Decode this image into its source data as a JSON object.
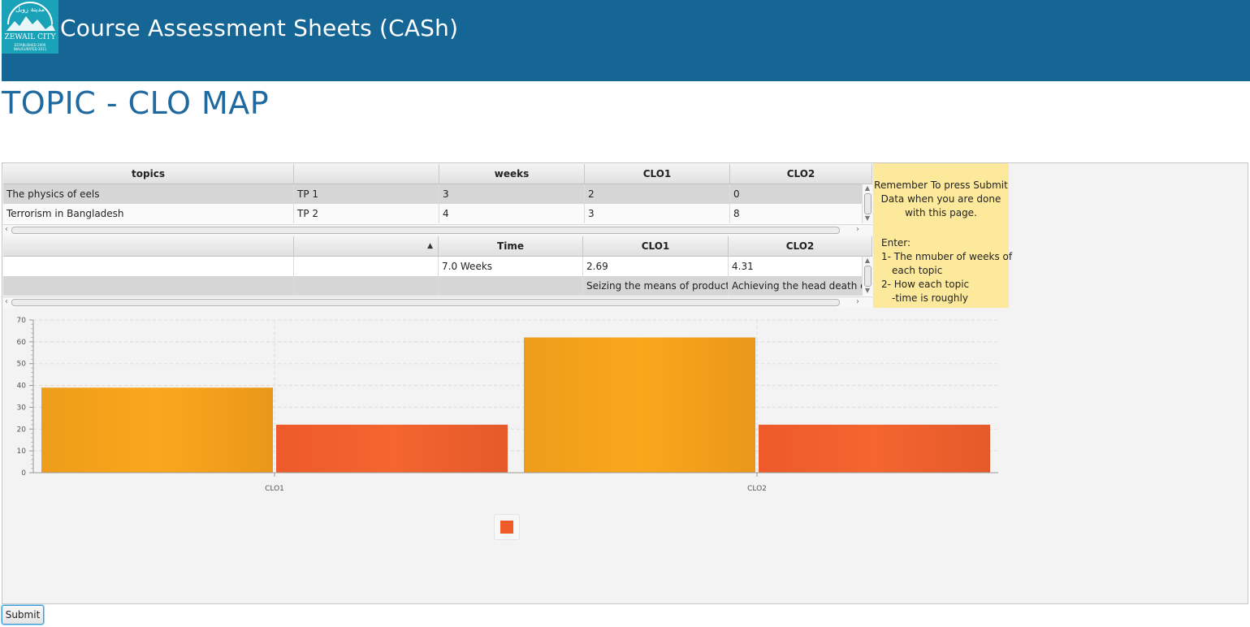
{
  "header": {
    "title": "Course Assessment Sheets (CASh)",
    "logo_text_ar": "مدينة زويل",
    "logo_text": "ZEWAIL CITY",
    "logo_sub1": "ESTABLISHED 2000",
    "logo_sub2": "INAUGURATED 2011"
  },
  "page_title": "TOPIC - CLO MAP",
  "topics_table": {
    "columns": [
      "topics",
      "",
      "weeks",
      "CLO1",
      "CLO2"
    ],
    "rows": [
      [
        "The physics of eels",
        "TP 1",
        "3",
        "2",
        "0"
      ],
      [
        "Terrorism in Bangladesh",
        "TP 2",
        "4",
        "3",
        "8"
      ]
    ]
  },
  "summary_table": {
    "columns": [
      "",
      "",
      "Time",
      "CLO1",
      "CLO2"
    ],
    "sort_icon": "sort-ascending-icon",
    "rows": [
      [
        "",
        "",
        "7.0 Weeks",
        "2.69",
        "4.31"
      ],
      [
        "",
        "",
        "",
        "Seizing the means of production",
        "Achieving the head death of t..."
      ]
    ]
  },
  "note": {
    "line1": "Remember To press Submit",
    "line2": "Data when you are done",
    "line3": "with this page.",
    "enter": "Enter:",
    "item1a": "1- The nmuber of weeks of",
    "item1b": "each topic",
    "item2a": "2- How each topic",
    "item2b": "-time is roughly"
  },
  "chart_data": {
    "type": "bar",
    "categories": [
      "CLO1",
      "CLO2"
    ],
    "series": [
      {
        "values": [
          39,
          62
        ],
        "color": "#f5a31c"
      },
      {
        "values": [
          22,
          22
        ],
        "color": "#f15a29"
      }
    ],
    "ylim": [
      0,
      70
    ],
    "yticks": [
      0,
      10,
      20,
      30,
      40,
      50,
      60,
      70
    ],
    "grid": true,
    "legend_placement": "bottom"
  },
  "submit_label": "Submit"
}
